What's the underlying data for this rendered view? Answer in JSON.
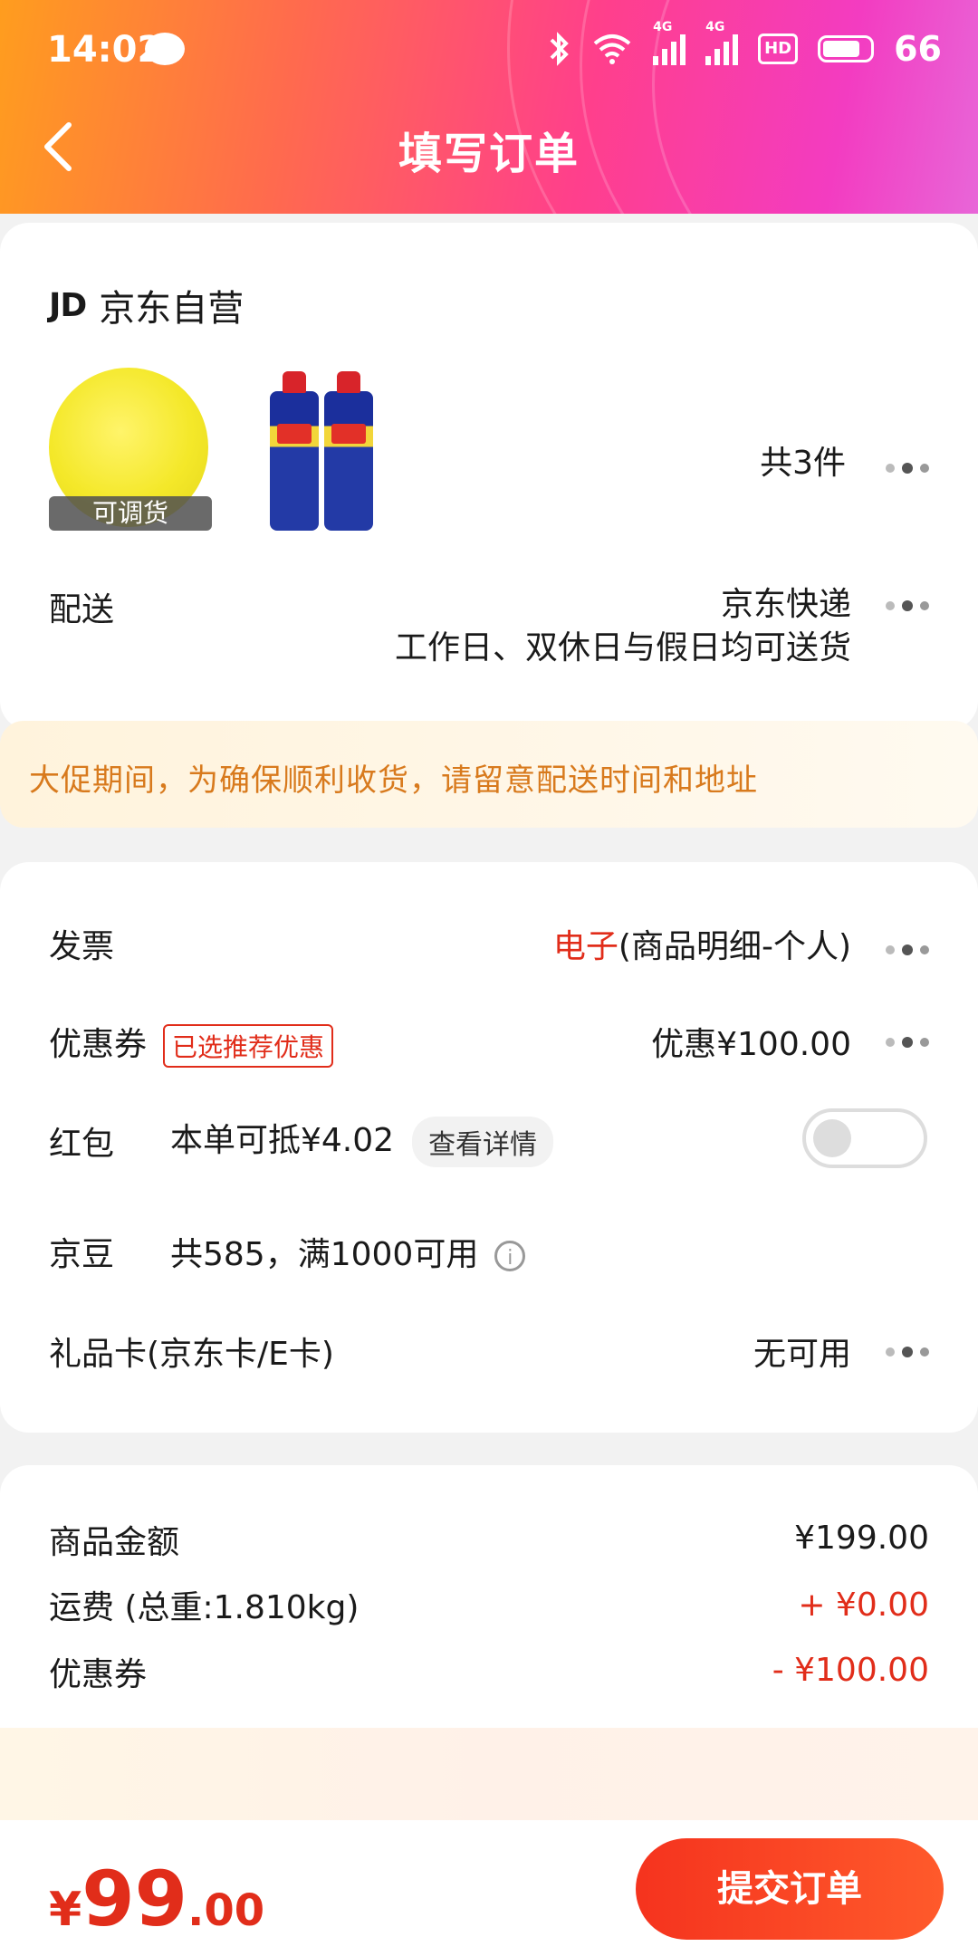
{
  "status_bar": {
    "time": "14:02",
    "battery": "66",
    "net_1": "4G",
    "net_2": "4G",
    "hd": "HD"
  },
  "header": {
    "title": "填写订单"
  },
  "order": {
    "shop_logo": "JD",
    "shop_name": "京东自营",
    "product_tag": "可调货",
    "count": "共3件",
    "delivery_label": "配送",
    "delivery_company": "京东快递",
    "delivery_time": "工作日、双休日与假日均可送货"
  },
  "notice": "大促期间，为确保顺利收货，请留意配送时间和地址",
  "options": {
    "invoice_label": "发票",
    "invoice_type": "电子",
    "invoice_detail": "(商品明细-个人)",
    "coupon_label": "优惠券",
    "coupon_tag": "已选推荐优惠",
    "coupon_value": "优惠¥100.00",
    "redpacket_label": "红包",
    "redpacket_value": "本单可抵¥4.02",
    "redpacket_detail": "查看详情",
    "redpacket_toggle_on": false,
    "jdbean_label": "京豆",
    "jdbean_value": "共585，满1000可用",
    "giftcard_label": "礼品卡(京东卡/E卡)",
    "giftcard_value": "无可用"
  },
  "summary": {
    "goods_label": "商品金额",
    "goods_value": "¥199.00",
    "freight_label": "运费 (总重:1.810kg)",
    "freight_value": "+ ¥0.00",
    "coupon_label": "优惠券",
    "coupon_value": "- ¥100.00"
  },
  "bottom": {
    "currency": "¥",
    "price_int": "99",
    "price_dec": ".00",
    "submit_label": "提交订单"
  },
  "colors": {
    "accent_red": "#e12d1a",
    "notice_text": "#d87a1d",
    "submit_bg": "#f5331e"
  }
}
